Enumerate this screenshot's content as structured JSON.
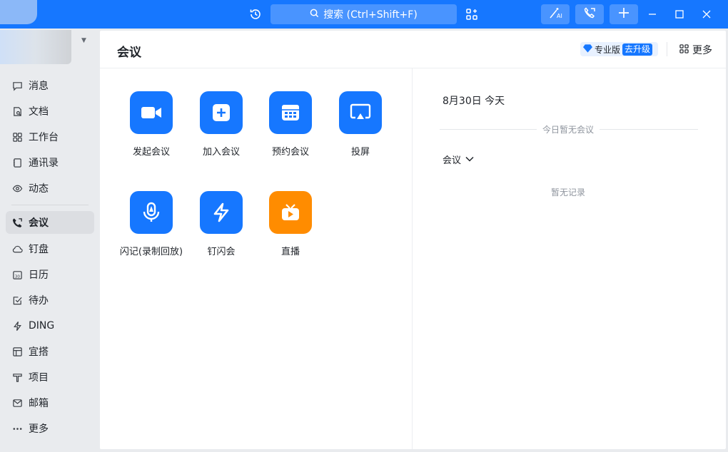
{
  "titlebar": {
    "search_placeholder": "搜索 (Ctrl+Shift+F)",
    "accent": "#1677ff",
    "icons": [
      "history-icon",
      "search-icon",
      "apps-add-icon",
      "ai-wand-icon",
      "call-icon",
      "plus-icon"
    ]
  },
  "sidebar": {
    "items": [
      {
        "label": "消息",
        "icon": "message-icon"
      },
      {
        "label": "文档",
        "icon": "document-icon"
      },
      {
        "label": "工作台",
        "icon": "workbench-icon"
      },
      {
        "label": "通讯录",
        "icon": "contacts-icon"
      },
      {
        "label": "动态",
        "icon": "feed-icon"
      },
      {
        "label": "会议",
        "icon": "meeting-icon",
        "active": true
      },
      {
        "label": "钉盘",
        "icon": "cloud-drive-icon"
      },
      {
        "label": "日历",
        "icon": "calendar-icon"
      },
      {
        "label": "待办",
        "icon": "todo-icon"
      },
      {
        "label": "DING",
        "icon": "ding-icon"
      },
      {
        "label": "宜搭",
        "icon": "yida-icon"
      },
      {
        "label": "项目",
        "icon": "project-icon"
      },
      {
        "label": "邮箱",
        "icon": "mail-icon"
      },
      {
        "label": "更多",
        "icon": "more-dots-icon"
      }
    ]
  },
  "header": {
    "title": "会议",
    "pro_label": "专业版",
    "upgrade_label": "去升级",
    "more_label": "更多"
  },
  "apps": [
    {
      "label": "发起会议",
      "icon": "video-camera-icon",
      "color": "#1677ff"
    },
    {
      "label": "加入会议",
      "icon": "join-plus-icon",
      "color": "#1677ff"
    },
    {
      "label": "预约会议",
      "icon": "schedule-calendar-icon",
      "color": "#1677ff"
    },
    {
      "label": "投屏",
      "icon": "screen-cast-icon",
      "color": "#1677ff"
    },
    {
      "label": "闪记(录制回放)",
      "icon": "mic-record-icon",
      "color": "#1677ff"
    },
    {
      "label": "钉闪会",
      "icon": "lightning-icon",
      "color": "#1677ff"
    },
    {
      "label": "直播",
      "icon": "live-tv-icon",
      "color": "#ff8c00"
    }
  ],
  "right": {
    "date": "8月30日 今天",
    "no_meeting": "今日暂无会议",
    "meeting_dropdown": "会议",
    "no_record": "暂无记录"
  }
}
